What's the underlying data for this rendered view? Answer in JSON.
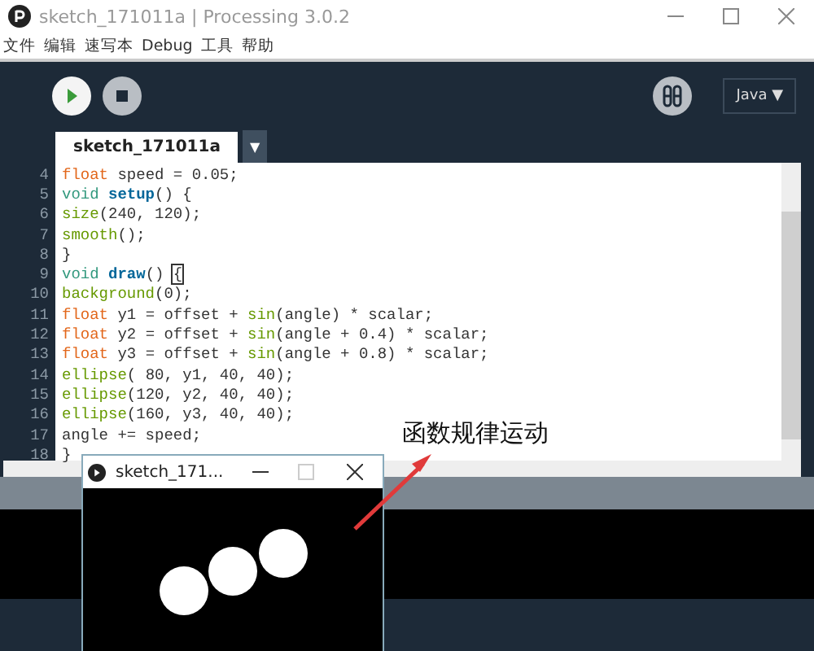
{
  "window": {
    "title": "sketch_171011a | Processing 3.0.2"
  },
  "menu": [
    "文件",
    "编辑",
    "速写本",
    "Debug",
    "工具",
    "帮助"
  ],
  "toolbar": {
    "mode": "Java ▼"
  },
  "tabs": [
    {
      "label": "sketch_171011a",
      "selected": true
    }
  ],
  "tab_menu": "▼",
  "editor": {
    "lines": [
      {
        "number": "4",
        "tokens": [
          {
            "kind": "type",
            "text": "float"
          },
          {
            "kind": "plain",
            "text": " speed = 0.05;"
          }
        ]
      },
      {
        "number": "5",
        "tokens": [
          {
            "kind": "keyword",
            "text": "void"
          },
          {
            "kind": "fn",
            "text": "setup"
          },
          {
            "kind": "plain",
            "text": "() {"
          }
        ]
      },
      {
        "number": "6",
        "tokens": [
          {
            "kind": "builtin",
            "text": "size"
          },
          {
            "kind": "plain",
            "text": "(240, 120);"
          }
        ]
      },
      {
        "number": "7",
        "tokens": [
          {
            "kind": "builtin",
            "text": "smooth"
          },
          {
            "kind": "plain",
            "text": "();"
          }
        ]
      },
      {
        "number": "8",
        "tokens": [
          {
            "kind": "plain",
            "text": "}"
          }
        ]
      },
      {
        "number": "9",
        "tokens": [
          {
            "kind": "keyword",
            "text": "void"
          },
          {
            "kind": "fn",
            "text": "draw"
          },
          {
            "kind": "plain",
            "text": "() "
          },
          {
            "kind": "match",
            "text": "{"
          }
        ]
      },
      {
        "number": "10",
        "tokens": [
          {
            "kind": "builtin",
            "text": "background"
          },
          {
            "kind": "plain",
            "text": "(0);"
          }
        ]
      },
      {
        "number": "11",
        "tokens": [
          {
            "kind": "type",
            "text": "float"
          },
          {
            "kind": "plain",
            "text": " y1 = offset + "
          },
          {
            "kind": "builtin",
            "text": "sin"
          },
          {
            "kind": "plain",
            "text": "(angle) * scalar;"
          }
        ]
      },
      {
        "number": "12",
        "tokens": [
          {
            "kind": "type",
            "text": "float"
          },
          {
            "kind": "plain",
            "text": " y2 = offset + "
          },
          {
            "kind": "builtin",
            "text": "sin"
          },
          {
            "kind": "plain",
            "text": "(angle + 0.4) * scalar;"
          }
        ]
      },
      {
        "number": "13",
        "tokens": [
          {
            "kind": "type",
            "text": "float"
          },
          {
            "kind": "plain",
            "text": " y3 = offset + "
          },
          {
            "kind": "builtin",
            "text": "sin"
          },
          {
            "kind": "plain",
            "text": "(angle + 0.8) * scalar;"
          }
        ]
      },
      {
        "number": "14",
        "tokens": [
          {
            "kind": "builtin",
            "text": "ellipse"
          },
          {
            "kind": "plain",
            "text": "( 80, y1, 40, 40);"
          }
        ]
      },
      {
        "number": "15",
        "tokens": [
          {
            "kind": "builtin",
            "text": "ellipse"
          },
          {
            "kind": "plain",
            "text": "(120, y2, 40, 40);"
          }
        ]
      },
      {
        "number": "16",
        "tokens": [
          {
            "kind": "builtin",
            "text": "ellipse"
          },
          {
            "kind": "plain",
            "text": "(160, y3, 40, 40);"
          }
        ]
      },
      {
        "number": "17",
        "tokens": [
          {
            "kind": "plain",
            "text": "angle += speed;"
          }
        ]
      },
      {
        "number": "18",
        "tokens": [
          {
            "kind": "plain",
            "text": "}"
          }
        ]
      }
    ]
  },
  "sketch_window": {
    "title": "sketch_171..."
  },
  "annotation": "函数规律运动"
}
